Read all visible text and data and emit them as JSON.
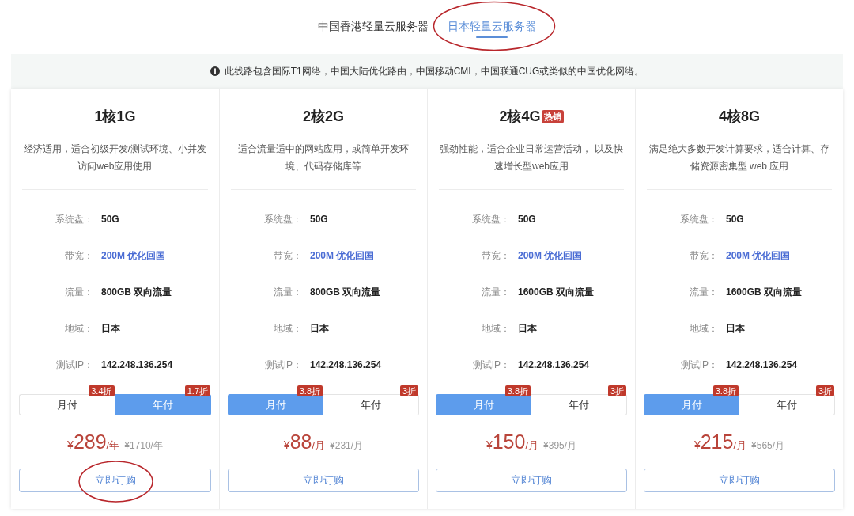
{
  "tabs": [
    {
      "label": "中国香港轻量云服务器",
      "selected": false,
      "circled": false
    },
    {
      "label": "日本轻量云服务器",
      "selected": true,
      "circled": true
    }
  ],
  "notice": {
    "text": "此线路包含国际T1网络，中国大陆优化路由，中国移动CMI，中国联通CUG或类似的中国优化网络。"
  },
  "plans": [
    {
      "title": "1核1G",
      "description": "经济适用，适合初级开发/测试环境、小并发访问web应用使用",
      "specs": [
        {
          "label": "系统盘：",
          "value": "50G",
          "highlighted": false
        },
        {
          "label": "带宽：",
          "value": "200M 优化回国",
          "highlighted": true
        },
        {
          "label": "流量：",
          "value": "800GB 双向流量",
          "highlighted": false
        },
        {
          "label": "地域：",
          "value": "日本",
          "highlighted": false
        },
        {
          "label": "测试IP：",
          "value": "142.248.136.254",
          "highlighted": false
        }
      ],
      "billing": [
        {
          "label": "月付",
          "discount": "3.4折",
          "selected": false
        },
        {
          "label": "年付",
          "discount": "1.7折",
          "selected": true
        }
      ],
      "price": {
        "currency": "¥",
        "amount": "289",
        "unit": "/年",
        "original": "¥1710/年"
      },
      "order": {
        "label": "立即订购",
        "circled": true
      }
    },
    {
      "title": "2核2G",
      "description": "适合流量适中的网站应用，或简单开发环境、代码存储库等",
      "specs": [
        {
          "label": "系统盘：",
          "value": "50G",
          "highlighted": false
        },
        {
          "label": "带宽：",
          "value": "200M 优化回国",
          "highlighted": true
        },
        {
          "label": "流量：",
          "value": "800GB 双向流量",
          "highlighted": false
        },
        {
          "label": "地域：",
          "value": "日本",
          "highlighted": false
        },
        {
          "label": "测试IP：",
          "value": "142.248.136.254",
          "highlighted": false
        }
      ],
      "billing": [
        {
          "label": "月付",
          "discount": "3.8折",
          "selected": true
        },
        {
          "label": "年付",
          "discount": "3折",
          "selected": false
        }
      ],
      "price": {
        "currency": "¥",
        "amount": "88",
        "unit": "/月",
        "original": "¥231/月"
      },
      "order": {
        "label": "立即订购",
        "circled": false
      }
    },
    {
      "title": "2核4G",
      "badge": "热销",
      "description": "强劲性能，适合企业日常运营活动， 以及快速增长型web应用",
      "specs": [
        {
          "label": "系统盘：",
          "value": "50G",
          "highlighted": false
        },
        {
          "label": "带宽：",
          "value": "200M 优化回国",
          "highlighted": true
        },
        {
          "label": "流量：",
          "value": "1600GB 双向流量",
          "highlighted": false
        },
        {
          "label": "地域：",
          "value": "日本",
          "highlighted": false
        },
        {
          "label": "测试IP：",
          "value": "142.248.136.254",
          "highlighted": false
        }
      ],
      "billing": [
        {
          "label": "月付",
          "discount": "3.8折",
          "selected": true
        },
        {
          "label": "年付",
          "discount": "3折",
          "selected": false
        }
      ],
      "price": {
        "currency": "¥",
        "amount": "150",
        "unit": "/月",
        "original": "¥395/月"
      },
      "order": {
        "label": "立即订购",
        "circled": false
      }
    },
    {
      "title": "4核8G",
      "description": "满足绝大多数开发计算要求，适合计算、存储资源密集型 web 应用",
      "specs": [
        {
          "label": "系统盘：",
          "value": "50G",
          "highlighted": false
        },
        {
          "label": "带宽：",
          "value": "200M 优化回国",
          "highlighted": true
        },
        {
          "label": "流量：",
          "value": "1600GB 双向流量",
          "highlighted": false
        },
        {
          "label": "地域：",
          "value": "日本",
          "highlighted": false
        },
        {
          "label": "测试IP：",
          "value": "142.248.136.254",
          "highlighted": false
        }
      ],
      "billing": [
        {
          "label": "月付",
          "discount": "3.8折",
          "selected": true
        },
        {
          "label": "年付",
          "discount": "3折",
          "selected": false
        }
      ],
      "price": {
        "currency": "¥",
        "amount": "215",
        "unit": "/月",
        "original": "¥565/月"
      },
      "order": {
        "label": "立即订购",
        "circled": false
      }
    }
  ]
}
